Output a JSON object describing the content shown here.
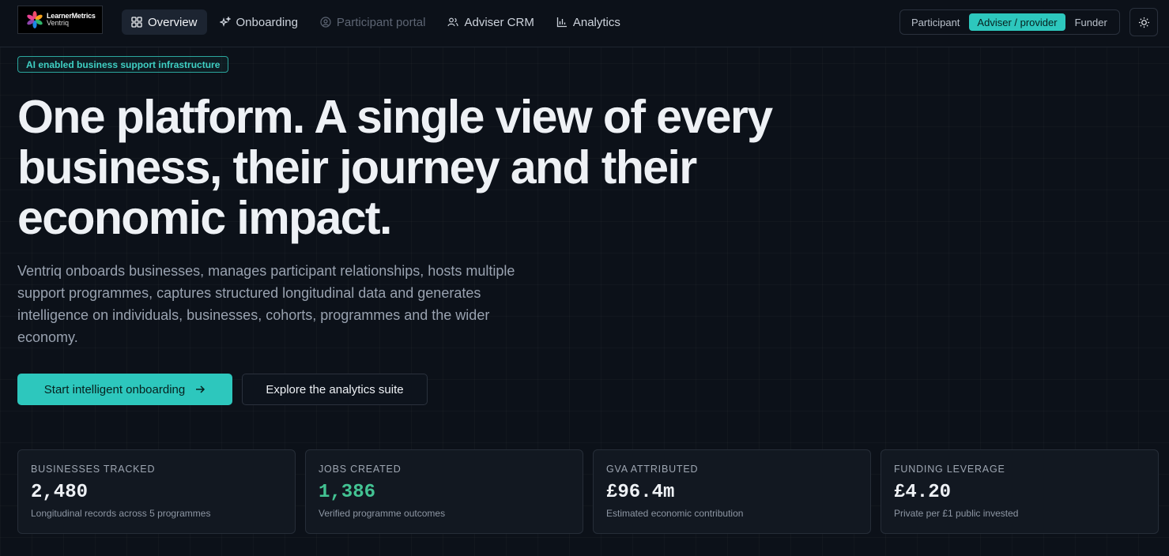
{
  "brand": {
    "line1": "LearnerMetrics",
    "line2": "Ventriq"
  },
  "nav": {
    "items": [
      {
        "label": "Overview",
        "icon": "grid-icon"
      },
      {
        "label": "Onboarding",
        "icon": "sparkle-icon"
      },
      {
        "label": "Participant portal",
        "icon": "user-circle-icon"
      },
      {
        "label": "Adviser CRM",
        "icon": "users-icon"
      },
      {
        "label": "Analytics",
        "icon": "bar-chart-icon"
      }
    ],
    "active": "Overview",
    "disabled": "Participant portal"
  },
  "roles": {
    "items": [
      "Participant",
      "Adviser / provider",
      "Funder"
    ],
    "selected": "Adviser / provider"
  },
  "theme_toggle_icon": "sun-icon",
  "hero": {
    "badge": "AI enabled business support infrastructure",
    "title": "One platform. A single view of every business, their journey and their economic impact.",
    "description": "Ventriq onboards businesses, manages participant relationships, hosts multiple support programmes, captures structured longitudinal data and generates intelligence on individuals, businesses, cohorts, programmes and the wider economy.",
    "primary_cta": "Start intelligent onboarding",
    "secondary_cta": "Explore the analytics suite"
  },
  "stats": [
    {
      "label": "BUSINESSES TRACKED",
      "value": "2,480",
      "sub": "Longitudinal records across 5 programmes"
    },
    {
      "label": "JOBS CREATED",
      "value": "1,386",
      "sub": "Verified programme outcomes"
    },
    {
      "label": "GVA ATTRIBUTED",
      "value": "£96.4m",
      "sub": "Estimated economic contribution"
    },
    {
      "label": "FUNDING LEVERAGE",
      "value": "£4.20",
      "sub": "Private per £1 public invested"
    }
  ],
  "colors": {
    "accent": "#2dc7bd",
    "positive": "#43c393",
    "background": "#0c1119"
  }
}
